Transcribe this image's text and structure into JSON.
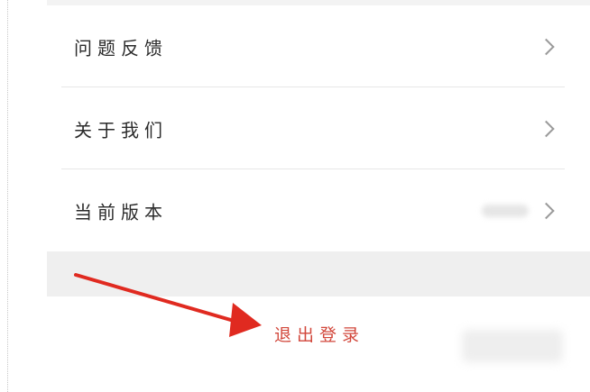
{
  "settings": {
    "items": [
      {
        "label": "问题反馈"
      },
      {
        "label": "关于我们"
      },
      {
        "label": "当前版本"
      }
    ]
  },
  "logout": {
    "label": "退出登录"
  },
  "annotation": {
    "arrow_color": "#e02a20"
  }
}
